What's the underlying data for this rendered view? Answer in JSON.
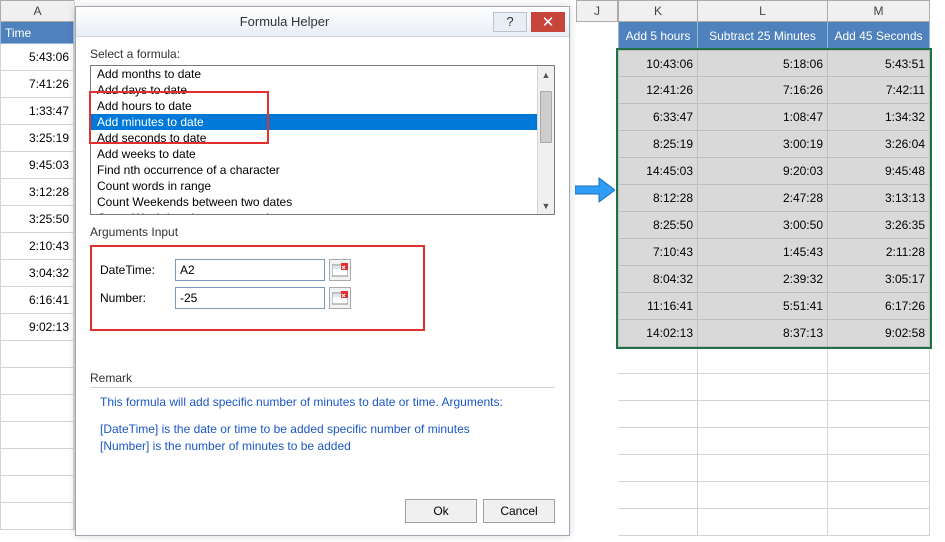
{
  "columns_left": {
    "A": "A"
  },
  "columns_right": {
    "J": "J",
    "K": "K",
    "L": "L",
    "M": "M"
  },
  "header_left": "Time",
  "headers_right": [
    "Add 5 hours",
    "Subtract 25 Minutes",
    "Add 45 Seconds"
  ],
  "times": [
    "5:43:06",
    "7:41:26",
    "1:33:47",
    "3:25:19",
    "9:45:03",
    "3:12:28",
    "3:25:50",
    "2:10:43",
    "3:04:32",
    "6:16:41",
    "9:02:13"
  ],
  "results": [
    [
      "10:43:06",
      "5:18:06",
      "5:43:51"
    ],
    [
      "12:41:26",
      "7:16:26",
      "7:42:11"
    ],
    [
      "6:33:47",
      "1:08:47",
      "1:34:32"
    ],
    [
      "8:25:19",
      "3:00:19",
      "3:26:04"
    ],
    [
      "14:45:03",
      "9:20:03",
      "9:45:48"
    ],
    [
      "8:12:28",
      "2:47:28",
      "3:13:13"
    ],
    [
      "8:25:50",
      "3:00:50",
      "3:26:35"
    ],
    [
      "7:10:43",
      "1:45:43",
      "2:11:28"
    ],
    [
      "8:04:32",
      "2:39:32",
      "3:05:17"
    ],
    [
      "11:16:41",
      "5:51:41",
      "6:17:26"
    ],
    [
      "14:02:13",
      "8:37:13",
      "9:02:58"
    ]
  ],
  "dialog": {
    "title": "Formula Helper",
    "select_label": "Select a formula:",
    "formulas": [
      "Add months to date",
      "Add days to date",
      "Add hours to date",
      "Add minutes to date",
      "Add seconds to date",
      "Add weeks to date",
      "Find nth occurrence of a character",
      "Count words in range",
      "Count Weekends between two dates",
      "Count Weekdays between two dates"
    ],
    "selected_index": 3,
    "arguments_label": "Arguments Input",
    "args": {
      "datetime_label": "DateTime:",
      "datetime_value": "A2",
      "number_label": "Number:",
      "number_value": "-25"
    },
    "remark_label": "Remark",
    "remark_line1": "This formula will add specific number of minutes to date or time. Arguments:",
    "remark_line2": "[DateTime] is the date or time to be added specific number of minutes",
    "remark_line3": "[Number] is the number of minutes to be added",
    "ok": "Ok",
    "cancel": "Cancel"
  }
}
